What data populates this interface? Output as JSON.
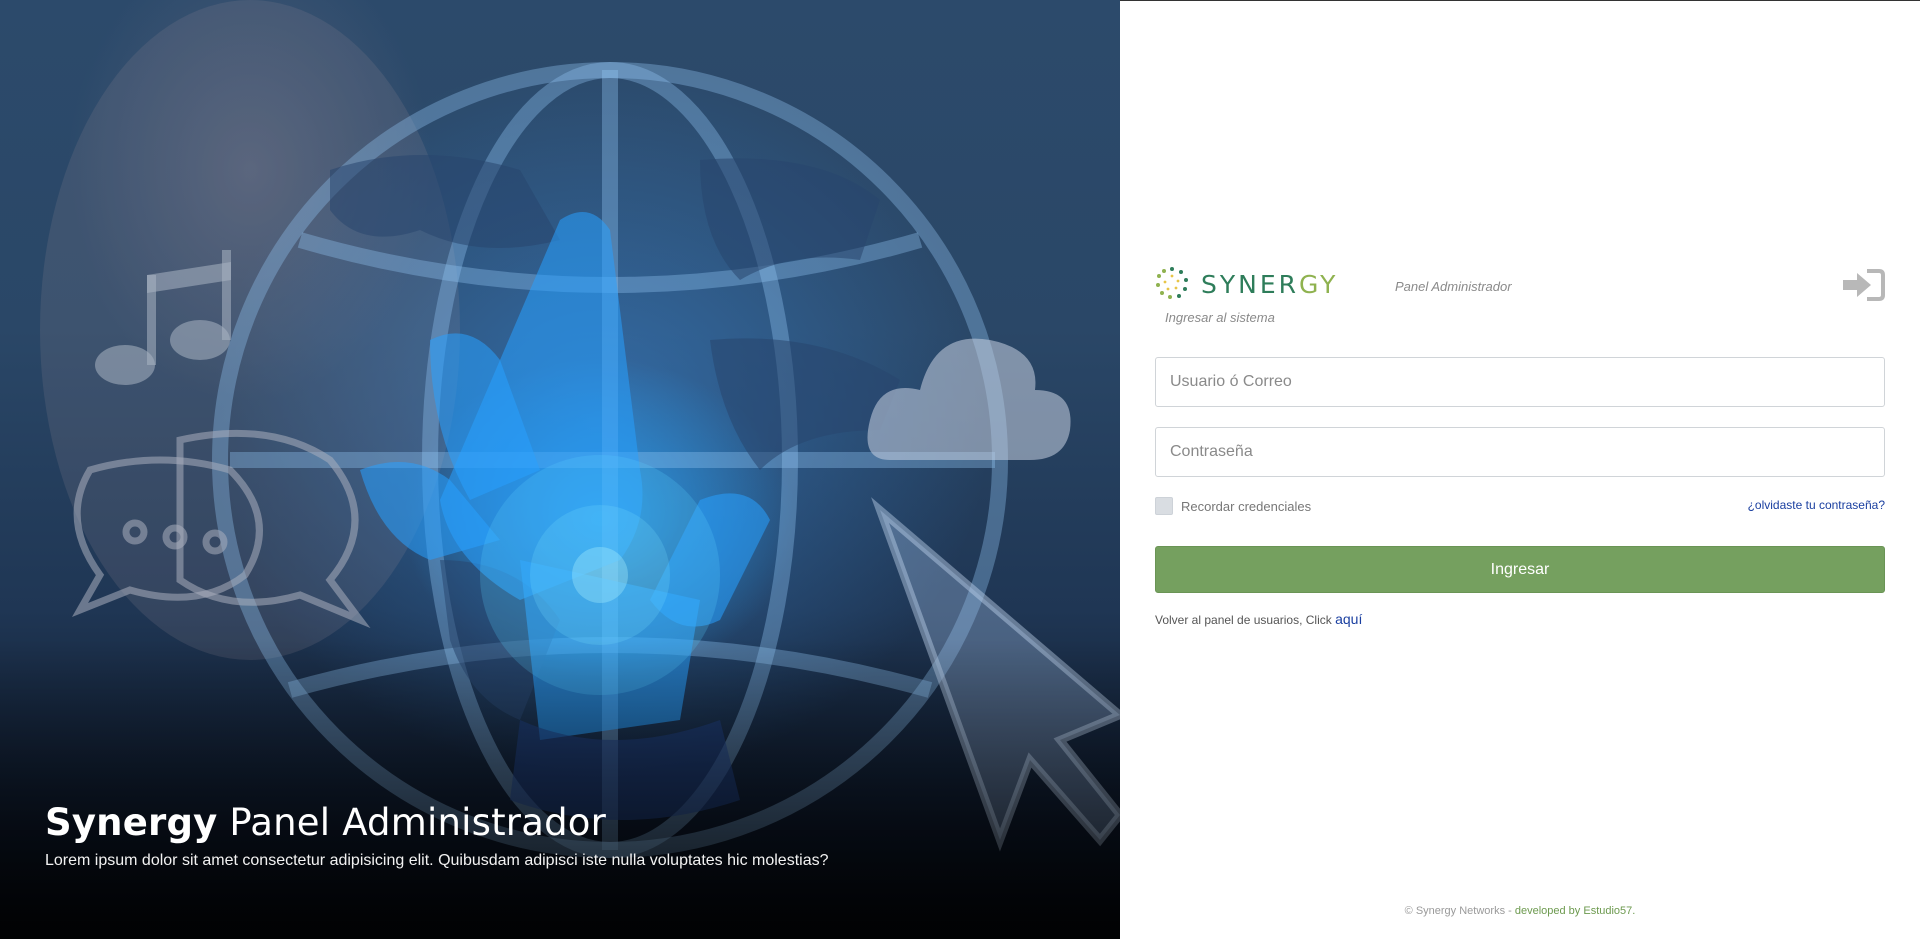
{
  "hero": {
    "title_bold": "Synergy",
    "title_light": "Panel Administrador",
    "description": "Lorem ipsum dolor sit amet consectetur adipisicing elit. Quibusdam adipisci iste nulla voluptates hic molestias?"
  },
  "brand": {
    "name_start": "SYNER",
    "name_end": "GY",
    "panel_label": "Panel Administrador",
    "subtitle": "Ingresar al sistema",
    "logo_icon": "synergy-dotted-ring-logo",
    "login_icon": "sign-in-icon"
  },
  "form": {
    "user_placeholder": "Usuario ó Correo",
    "password_placeholder": "Contraseña",
    "remember_label": "Recordar credenciales",
    "forgot_label": "¿olvidaste tu contraseña?",
    "submit_label": "Ingresar",
    "back_text": "Volver al panel de usuarios, Click",
    "back_link": "aquí"
  },
  "footer": {
    "copyright": "© Synergy Networks -",
    "developed": "developed by Estudio57."
  },
  "colors": {
    "accent_green": "#75a05f",
    "brand_teal": "#2e7d5a",
    "brand_lime": "#8fb24f",
    "link_blue": "#1a3fa0"
  }
}
